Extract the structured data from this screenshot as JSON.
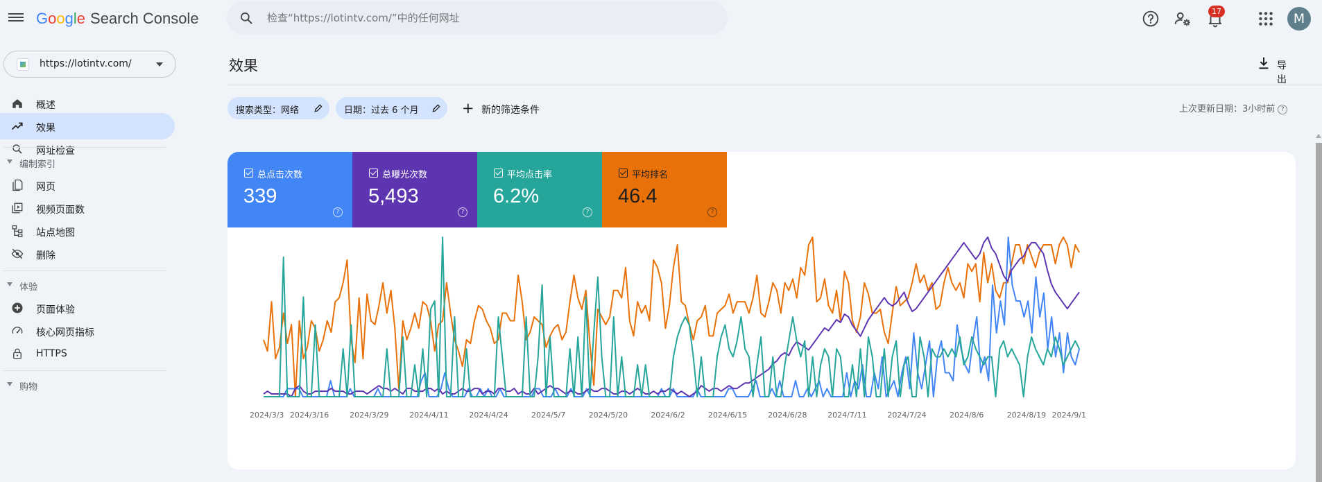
{
  "header": {
    "logo": {
      "G": "G",
      "o1": "o",
      "o2": "o",
      "g": "g",
      "l": "l",
      "e": "e",
      "product": "Search Console"
    },
    "search_placeholder": "检查“https://lotintv.com/”中的任何网址",
    "notification_count": "17",
    "avatar_letter": "M",
    "icons": [
      "menu-icon",
      "search-icon",
      "help-icon",
      "admin-settings-icon",
      "notifications-icon",
      "apps-icon"
    ]
  },
  "sidebar": {
    "property_url": "https://lotintv.com/",
    "items": [
      {
        "label": "概述",
        "icon": "home-icon"
      },
      {
        "label": "效果",
        "icon": "trending-up-icon",
        "active": true
      },
      {
        "label": "网址检查",
        "icon": "search-icon"
      }
    ],
    "sections": [
      {
        "label": "编制索引",
        "items": [
          {
            "label": "网页",
            "icon": "pages-icon"
          },
          {
            "label": "视频页面数",
            "icon": "video-page-icon"
          },
          {
            "label": "站点地图",
            "icon": "sitemap-icon"
          },
          {
            "label": "删除",
            "icon": "visibility-off-icon"
          }
        ]
      },
      {
        "label": "体验",
        "items": [
          {
            "label": "页面体验",
            "icon": "page-experience-icon"
          },
          {
            "label": "核心网页指标",
            "icon": "speed-icon"
          },
          {
            "label": "HTTPS",
            "icon": "lock-icon"
          }
        ]
      },
      {
        "label": "购物",
        "items": []
      }
    ]
  },
  "main": {
    "title": "效果",
    "export_label": "导出",
    "filters": [
      {
        "label": "搜索类型：网络"
      },
      {
        "label": "日期：过去 6 个月"
      }
    ],
    "add_filter_label": "新的筛选条件",
    "last_updated": "上次更新日期：3小时前",
    "metrics": [
      {
        "name": "总点击次数",
        "value": "339",
        "color": "#4285f4"
      },
      {
        "name": "总曝光次数",
        "value": "5,493",
        "color": "#5e35b1"
      },
      {
        "name": "平均点击率",
        "value": "6.2%",
        "color": "#26a69a"
      },
      {
        "name": "平均排名",
        "value": "46.4",
        "color": "#e8710a"
      }
    ]
  },
  "chart_data": {
    "type": "line",
    "x_ticks": [
      "2024/3/3",
      "2024/3/16",
      "2024/3/29",
      "2024/4/11",
      "2024/4/24",
      "2024/5/7",
      "2024/5/20",
      "2024/6/2",
      "2024/6/15",
      "2024/6/28",
      "2024/7/11",
      "2024/7/24",
      "2024/8/6",
      "2024/8/19",
      "2024/9/1"
    ],
    "grid": false,
    "legend": "metric cards above chart",
    "series": [
      {
        "name": "平均排名",
        "color": "#e8710a",
        "values": [
          45,
          42,
          55,
          40,
          43,
          52,
          44,
          49,
          30,
          50,
          40,
          43,
          50,
          48,
          42,
          45,
          50,
          47,
          55,
          56,
          60,
          66,
          45,
          39,
          56,
          40,
          57,
          50,
          49,
          54,
          60,
          52,
          58,
          48,
          32,
          50,
          45,
          48,
          52,
          48,
          55,
          54,
          50,
          42,
          49,
          50,
          60,
          52,
          45,
          42,
          38,
          45,
          44,
          50,
          54,
          53,
          50,
          48,
          44,
          45,
          52,
          52,
          50,
          50,
          62,
          55,
          45,
          47,
          51,
          50,
          49,
          43,
          46,
          48,
          49,
          45,
          47,
          55,
          62,
          56,
          53,
          58,
          44,
          33,
          53,
          51,
          49,
          51,
          58,
          58,
          56,
          64,
          50,
          46,
          55,
          52,
          54,
          50,
          66,
          64,
          60,
          48,
          54,
          64,
          70,
          55,
          54,
          49,
          45,
          50,
          51,
          54,
          46,
          46,
          52,
          53,
          54,
          57,
          52,
          55,
          55,
          55,
          52,
          56,
          62,
          52,
          51,
          55,
          60,
          58,
          52,
          60,
          58,
          61,
          56,
          64,
          62,
          70,
          72,
          55,
          56,
          61,
          54,
          52,
          58,
          50,
          63,
          60,
          50,
          47,
          51,
          60,
          57,
          52,
          52,
          53,
          47,
          44,
          52,
          59,
          54,
          55,
          56,
          60,
          65,
          60,
          62,
          58,
          60,
          53,
          54,
          60,
          64,
          60,
          58,
          60,
          56,
          65,
          63,
          65,
          55,
          68,
          60,
          65,
          58,
          56,
          60,
          60,
          65,
          70,
          70,
          65,
          70,
          67,
          64,
          68,
          70,
          70,
          70,
          65,
          70,
          72,
          70,
          64,
          70,
          68
        ]
      },
      {
        "name": "总点击次数",
        "color": "#4285f4",
        "values": [
          0,
          0,
          0,
          0,
          0,
          0,
          1,
          1,
          1,
          1,
          0,
          0,
          0,
          0,
          0,
          0,
          0,
          2,
          0,
          0,
          0,
          0,
          1,
          0,
          0,
          0,
          0,
          0,
          0,
          1,
          0,
          0,
          0,
          0,
          0,
          0,
          0,
          0,
          0,
          0,
          2,
          3,
          0,
          0,
          0,
          1,
          3,
          1,
          0,
          0,
          0,
          0,
          1,
          0,
          0,
          1,
          0,
          1,
          0,
          0,
          1,
          0,
          0,
          0,
          0,
          0,
          0,
          0,
          0,
          1,
          1,
          0,
          0,
          0,
          1,
          0,
          0,
          0,
          1,
          0,
          0,
          0,
          1,
          0,
          0,
          0,
          0,
          0,
          0,
          0,
          0,
          0,
          0,
          0,
          0,
          0,
          0,
          0,
          0,
          0,
          0,
          1,
          0,
          0,
          1,
          0,
          0,
          0,
          0,
          0,
          1,
          0,
          0,
          0,
          0,
          0,
          0,
          0,
          1,
          1,
          0,
          0,
          0,
          0,
          1,
          2,
          0,
          0,
          0,
          1,
          0,
          2,
          0,
          0,
          0,
          2,
          0,
          0,
          1,
          0,
          1,
          2,
          0,
          1,
          0,
          0,
          0,
          0,
          3,
          0,
          2,
          1,
          4,
          0,
          0,
          3,
          1,
          5,
          0,
          1,
          2,
          0,
          3,
          5,
          1,
          8,
          3,
          1,
          4,
          7,
          0,
          5,
          7,
          3,
          3,
          2,
          9,
          6,
          4,
          3,
          7,
          10,
          3,
          5,
          2,
          14,
          8,
          12,
          9,
          20,
          14,
          12,
          12,
          10,
          12,
          8,
          15,
          10,
          13,
          6,
          10,
          5,
          8,
          3,
          8,
          5,
          4,
          6
        ]
      },
      {
        "name": "总曝光次数",
        "color": "#5e35b1",
        "values": [
          5,
          6,
          5,
          5,
          5,
          5,
          5,
          4,
          7,
          8,
          6,
          5,
          5,
          6,
          6,
          6,
          6,
          7,
          6,
          6,
          6,
          5,
          5,
          6,
          6,
          6,
          5,
          6,
          7,
          8,
          7,
          7,
          6,
          7,
          6,
          5,
          7,
          7,
          6,
          6,
          6,
          7,
          7,
          6,
          7,
          5,
          6,
          5,
          5,
          6,
          7,
          6,
          6,
          7,
          7,
          5,
          6,
          6,
          5,
          7,
          7,
          6,
          6,
          7,
          5,
          6,
          5,
          5,
          7,
          5,
          6,
          7,
          8,
          7,
          7,
          6,
          5,
          6,
          6,
          5,
          5,
          6,
          7,
          6,
          6,
          7,
          7,
          6,
          5,
          5,
          6,
          6,
          5,
          6,
          7,
          6,
          5,
          5,
          6,
          5,
          6,
          6,
          7,
          6,
          5,
          6,
          5,
          4,
          5,
          6,
          8,
          7,
          6,
          7,
          7,
          6,
          7,
          8,
          7,
          7,
          8,
          9,
          9,
          10,
          11,
          12,
          13,
          14,
          16,
          17,
          19,
          20,
          19,
          22,
          24,
          23,
          22,
          21,
          23,
          25,
          27,
          29,
          28,
          30,
          32,
          31,
          34,
          33,
          30,
          28,
          26,
          29,
          32,
          34,
          36,
          38,
          40,
          38,
          37,
          38,
          40,
          42,
          38,
          35,
          36,
          38,
          40,
          42,
          44,
          46,
          48,
          50,
          52,
          54,
          56,
          58,
          60,
          58,
          56,
          54,
          56,
          60,
          62,
          58,
          56,
          52,
          48,
          46,
          50,
          52,
          54,
          55,
          58,
          60,
          60,
          58,
          56,
          50,
          45,
          42,
          40,
          38,
          36,
          38,
          40,
          42
        ]
      },
      {
        "name": "平均点击率",
        "color": "#26a69a",
        "values": [
          0,
          0,
          0,
          0,
          0,
          35,
          0,
          0,
          0,
          0,
          25,
          0,
          0,
          18,
          0,
          0,
          0,
          0,
          0,
          0,
          12,
          0,
          18,
          0,
          0,
          0,
          0,
          0,
          0,
          0,
          0,
          12,
          0,
          0,
          0,
          15,
          0,
          0,
          8,
          0,
          12,
          0,
          22,
          24,
          0,
          40,
          0,
          0,
          20,
          0,
          0,
          12,
          0,
          0,
          0,
          0,
          0,
          0,
          0,
          20,
          10,
          0,
          0,
          0,
          0,
          0,
          20,
          0,
          0,
          10,
          28,
          0,
          15,
          0,
          0,
          0,
          0,
          12,
          0,
          15,
          0,
          25,
          0,
          16,
          30,
          10,
          0,
          0,
          20,
          0,
          10,
          0,
          0,
          0,
          8,
          0,
          8,
          0,
          0,
          0,
          0,
          0,
          0,
          10,
          15,
          18,
          20,
          18,
          10,
          0,
          10,
          0,
          0,
          0,
          10,
          15,
          18,
          12,
          10,
          14,
          20,
          12,
          10,
          0,
          8,
          15,
          0,
          0,
          10,
          0,
          0,
          8,
          14,
          20,
          14,
          10,
          14,
          0,
          10,
          0,
          8,
          12,
          10,
          0,
          12,
          10,
          0,
          0,
          8,
          0,
          12,
          0,
          15,
          10,
          0,
          0,
          12,
          0,
          10,
          14,
          0,
          8,
          10,
          0,
          0,
          15,
          10,
          0,
          12,
          10,
          10,
          12,
          10,
          12,
          10,
          15,
          8,
          10,
          15,
          12,
          10,
          8,
          10,
          10,
          0,
          12,
          14,
          10,
          12,
          10,
          8,
          0,
          10,
          15,
          12,
          10,
          8,
          12,
          10,
          15,
          12,
          8,
          10,
          12,
          14,
          12
        ]
      }
    ]
  }
}
